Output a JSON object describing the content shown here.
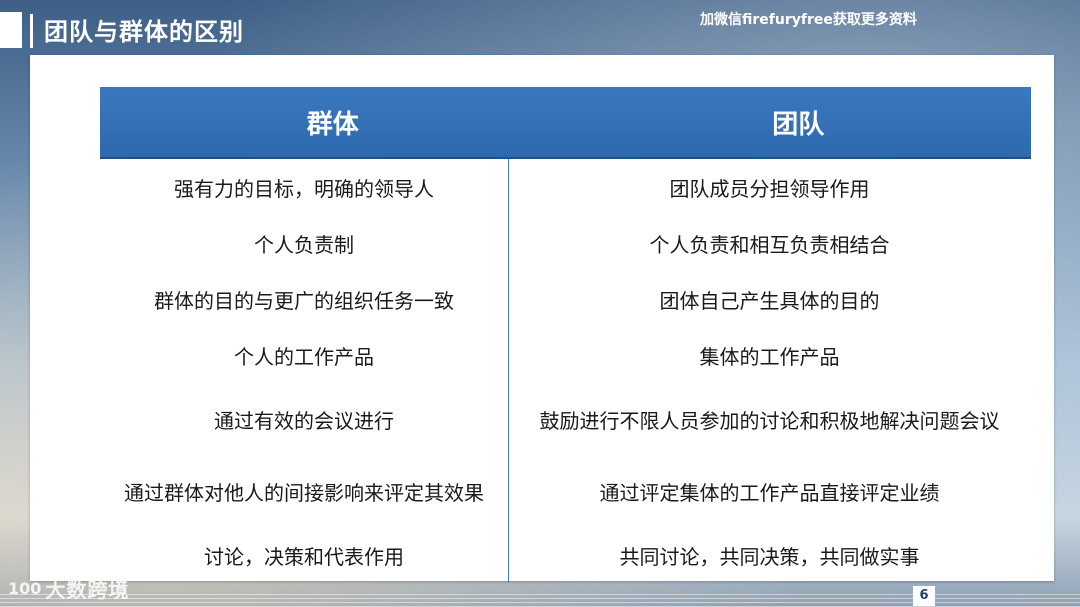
{
  "header": {
    "title": "团队与群体的区别",
    "watermark": "加微信firefuryfree获取更多资料"
  },
  "table": {
    "columns": [
      "群体",
      "团队"
    ],
    "rows": [
      [
        "强有力的目标，明确的领导人",
        "团队成员分担领导作用"
      ],
      [
        "个人负责制",
        "个人负责和相互负责相结合"
      ],
      [
        "群体的目的与更广的组织任务一致",
        "团体自己产生具体的目的"
      ],
      [
        "个人的工作产品",
        "集体的工作产品"
      ],
      [
        "通过有效的会议进行",
        "鼓励进行不限人员参加的讨论和积极地解决问题会议"
      ],
      [
        "通过群体对他人的间接影响来评定其效果",
        "通过评定集体的工作产品直接评定业绩"
      ],
      [
        "讨论，决策和代表作用",
        "共同讨论，共同决策，共同做实事"
      ]
    ]
  },
  "footer": {
    "logo_mark": "100",
    "logo_text": "大数跨境",
    "page_number": "6"
  },
  "colors": {
    "header_blue": "#2e69ad",
    "divider_blue": "#4b7fb7"
  }
}
